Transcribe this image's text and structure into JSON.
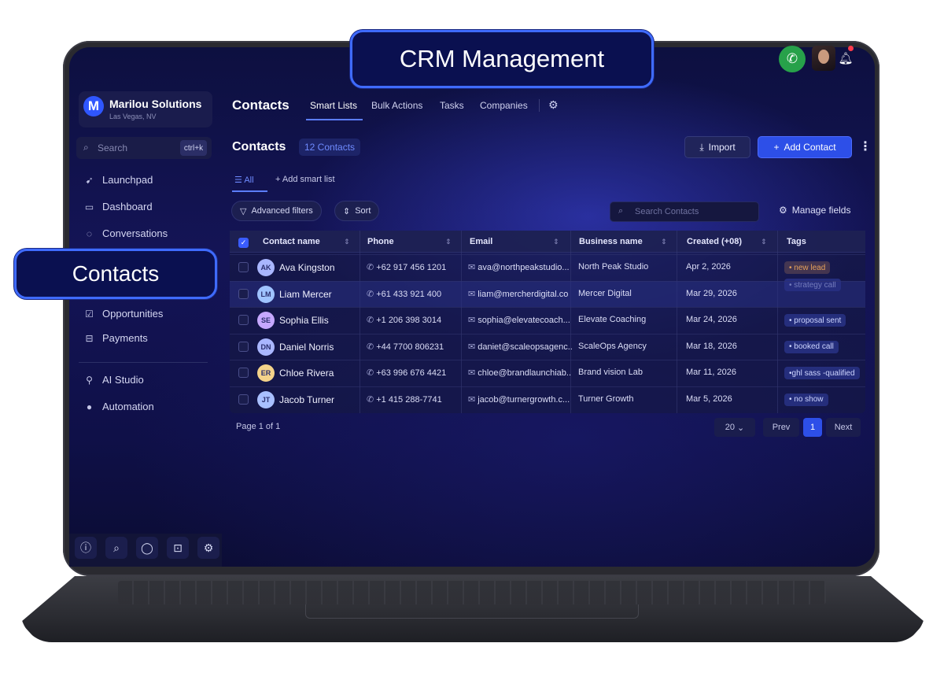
{
  "callouts": {
    "top": "CRM Management",
    "left": "Contacts"
  },
  "brand": {
    "logo_letter": "M",
    "name": "Marilou Solutions",
    "location": "Las Vegas, NV"
  },
  "sidebar": {
    "search_placeholder": "Search",
    "search_shortcut": "ctrl+k",
    "items": [
      {
        "label": "Launchpad",
        "icon": "rocket-icon"
      },
      {
        "label": "Dashboard",
        "icon": "monitor-icon"
      },
      {
        "label": "Conversations",
        "icon": "chat-icon"
      },
      {
        "label": "Opportunities",
        "icon": "check-square-icon"
      },
      {
        "label": "Payments",
        "icon": "wallet-icon"
      },
      {
        "label": "AI Studio",
        "icon": "ai-icon"
      },
      {
        "label": "Automation",
        "icon": "people-icon"
      }
    ],
    "bottom_icons": [
      "info-icon",
      "search-icon",
      "chat-bubble-icon",
      "lock-icon",
      "gear-icon"
    ]
  },
  "topbar": {
    "heading": "Contacts",
    "tabs": [
      "Smart Lists",
      "Bulk Actions",
      "Tasks",
      "Companies"
    ]
  },
  "section": {
    "title": "Contacts",
    "count": "12 Contacts",
    "import_label": "Import",
    "add_label": "Add Contact"
  },
  "subtabs": {
    "all": "All",
    "add": "Add smart list"
  },
  "filters": {
    "advanced": "Advanced filters",
    "sort": "Sort",
    "search_placeholder": "Search Contacts",
    "manage": "Manage fields"
  },
  "table": {
    "headers": [
      "Contact name",
      "Phone",
      "Email",
      "Business name",
      "Created (+08)",
      "Tags"
    ],
    "rows": [
      {
        "initials": "AK",
        "name": "Ava Kingston",
        "phone": "+62 917 456 1201",
        "email": "ava@northpeakstudio...",
        "business": "North Peak Studio",
        "created": "Apr 2, 2026",
        "tags": [
          "• new lead",
          "• strategy call"
        ],
        "avatar_color": "#a9b6ff"
      },
      {
        "initials": "LM",
        "name": "Liam Mercer",
        "phone": "+61 433 921 400",
        "email": "liam@mercherdigital.co",
        "business": "Mercer Digital",
        "created": "Mar 29, 2026",
        "tags": [],
        "avatar_color": "#9fc3ff"
      },
      {
        "initials": "SE",
        "name": "Sophia Ellis",
        "phone": "+1 206 398 3014",
        "email": "sophia@elevatecoach...",
        "business": "Elevate Coaching",
        "created": "Mar 24, 2026",
        "tags": [
          "• proposal sent"
        ],
        "avatar_color": "#c6a8ff"
      },
      {
        "initials": "DN",
        "name": "Daniel Norris",
        "phone": "+44 7700 806231",
        "email": "daniet@scaleopsagenc...",
        "business": "ScaleOps Agency",
        "created": "Mar 18, 2026",
        "tags": [
          "• booked call"
        ],
        "avatar_color": "#a9b6ff"
      },
      {
        "initials": "ER",
        "name": "Chloe Rivera",
        "phone": "+63 996 676 4421",
        "email": "chloe@brandlaunchiab..",
        "business": "Brand vision Lab",
        "created": "Mar 11, 2026",
        "tags": [
          "•ghl sass -qualified"
        ],
        "avatar_color": "#f4d38a"
      },
      {
        "initials": "JT",
        "name": "Jacob Turner",
        "phone": "+1 415 288-7741",
        "email": "jacob@turnergrowth.c...",
        "business": "Turner Growth",
        "created": "Mar 5, 2026",
        "tags": [
          "• no show"
        ],
        "avatar_color": "#a9c0ff"
      }
    ]
  },
  "pagination": {
    "info": "Page 1 of 1",
    "page_size": "20",
    "prev": "Prev",
    "current": "1",
    "next": "Next"
  },
  "colors": {
    "accent": "#2d4fe8",
    "tag_new_lead": "#e6a15a",
    "tag_default": "#8ea2ff"
  }
}
